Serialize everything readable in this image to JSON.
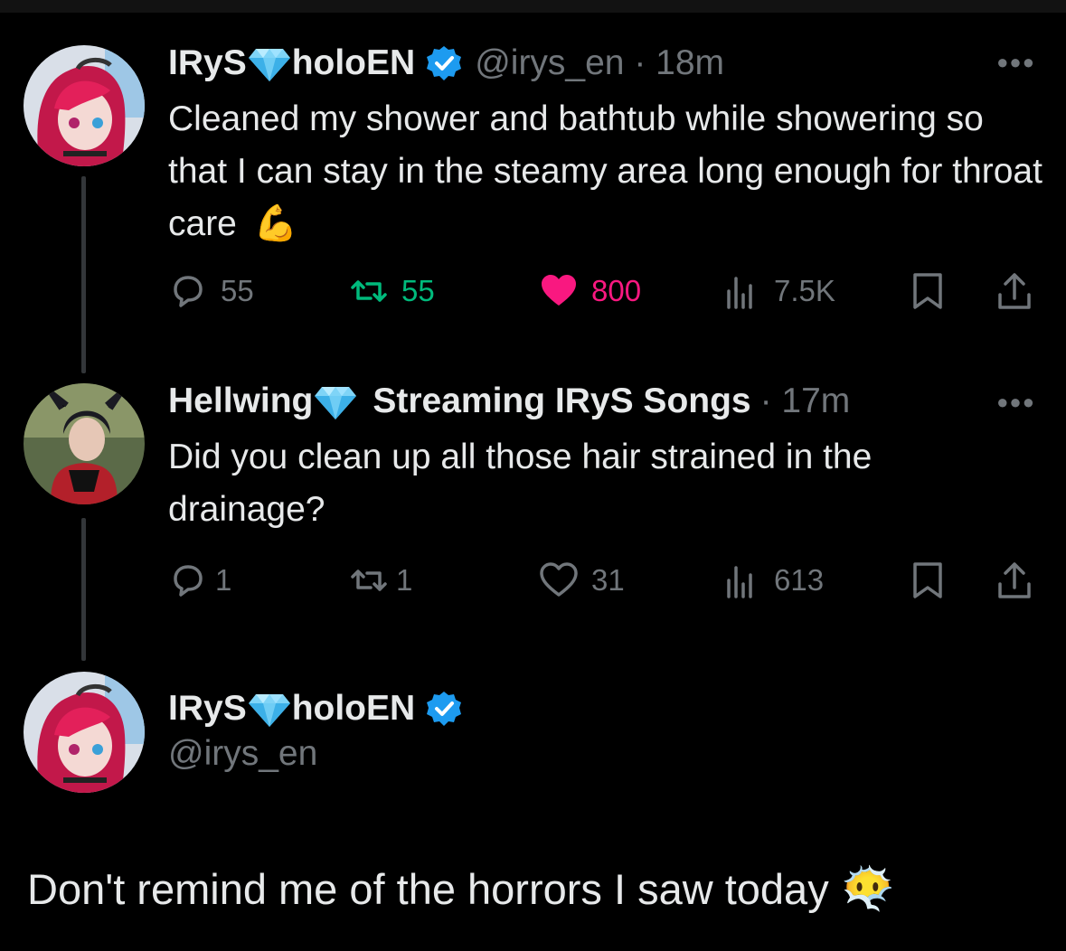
{
  "thread": {
    "tweet1": {
      "name_left": "IRyS",
      "name_right": "holoEN",
      "handle_time": "@irys_en · 18m",
      "text": "Cleaned my shower and bathtub while showering so that I can stay in the steamy area long enough for throat care",
      "emoji": "💪",
      "replies": "55",
      "reposts": "55",
      "likes": "800",
      "views": "7.5K",
      "liked": true,
      "reposted": true,
      "accent": {
        "repost": "#00ba7c",
        "like": "#f91880",
        "verified": "#1d9bf0"
      }
    },
    "tweet2": {
      "name_left": "Hellwing",
      "name_right": "Streaming IRyS Songs",
      "handle_time": "· 17m",
      "text": "Did you clean up all those hair strained in the drainage?",
      "replies": "1",
      "reposts": "1",
      "likes": "31",
      "views": "613"
    },
    "main_tweet": {
      "name_left": "IRyS",
      "name_right": "holoEN",
      "handle": "@irys_en",
      "text": "Don't remind me of the horrors I saw today",
      "emoji": "😶‍🌫️"
    }
  },
  "icons": [
    "more-icon",
    "reply-icon",
    "repost-icon",
    "like-icon",
    "views-icon",
    "bookmark-icon",
    "share-icon",
    "verified-icon",
    "gem-icon"
  ]
}
